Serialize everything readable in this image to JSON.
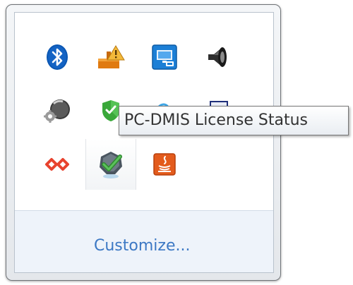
{
  "flyout": {
    "icons": [
      {
        "name": "bluetooth-icon"
      },
      {
        "name": "network-warning-icon"
      },
      {
        "name": "intel-graphics-icon"
      },
      {
        "name": "speaker-icon"
      },
      {
        "name": "gear-disc-icon"
      },
      {
        "name": "security-shield-icon"
      },
      {
        "name": "cloud-icon"
      },
      {
        "name": "monitor-icon"
      },
      {
        "name": "infinity-link-icon"
      },
      {
        "name": "pc-dmis-license-icon",
        "selected": true
      },
      {
        "name": "java-update-icon"
      }
    ],
    "customize_label": "Customize..."
  },
  "tooltip": {
    "text": "PC-DMIS License Status"
  },
  "colors": {
    "link": "#3c78c4",
    "customize_background": "#eef3fa",
    "tooltip_text": "#333333"
  }
}
